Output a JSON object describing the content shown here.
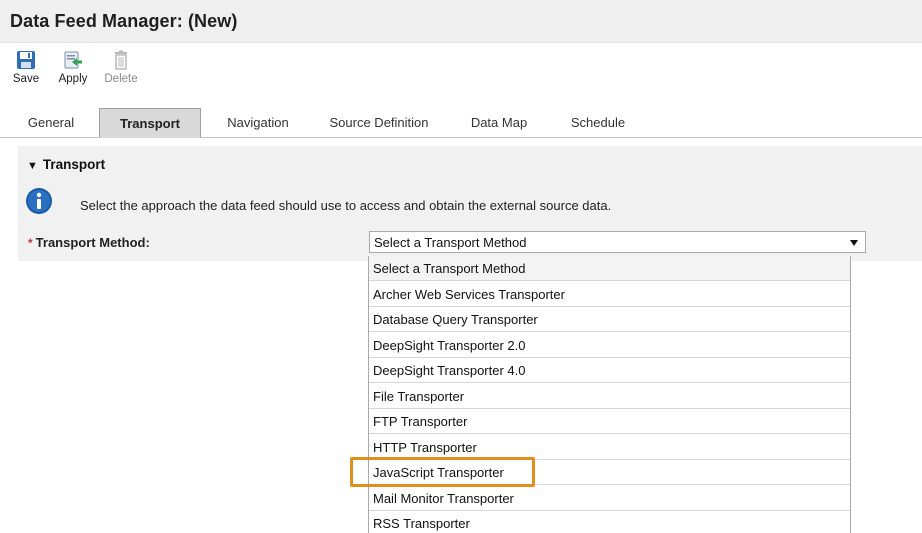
{
  "window": {
    "title": "Data Feed Manager: (New)"
  },
  "toolbar": {
    "save_label": "Save",
    "apply_label": "Apply",
    "delete_label": "Delete",
    "icons": {
      "save": "save-disk-icon",
      "apply": "apply-icon",
      "delete": "trash-icon"
    }
  },
  "tabs": [
    {
      "label": "General"
    },
    {
      "label": "Transport",
      "active": true
    },
    {
      "label": "Navigation"
    },
    {
      "label": "Source Definition"
    },
    {
      "label": "Data Map"
    },
    {
      "label": "Schedule"
    }
  ],
  "transport": {
    "section_title": "Transport",
    "info_text": "Select the approach the data feed should use to access and obtain the external source data.",
    "field_label": "Transport Method:",
    "required_mark": "*",
    "selected_value": "Select a Transport Method",
    "options": [
      "Select a Transport Method",
      "Archer Web Services Transporter",
      "Database Query Transporter",
      "DeepSight Transporter 2.0",
      "DeepSight Transporter 4.0",
      "File Transporter",
      "FTP Transporter",
      "HTTP Transporter",
      "JavaScript Transporter",
      "Mail Monitor Transporter",
      "RSS Transporter"
    ],
    "highlighted_option": "JavaScript Transporter"
  },
  "colors": {
    "highlight": "#e08e1d",
    "required": "#c0392b",
    "info_icon": "#1a5aa6"
  }
}
